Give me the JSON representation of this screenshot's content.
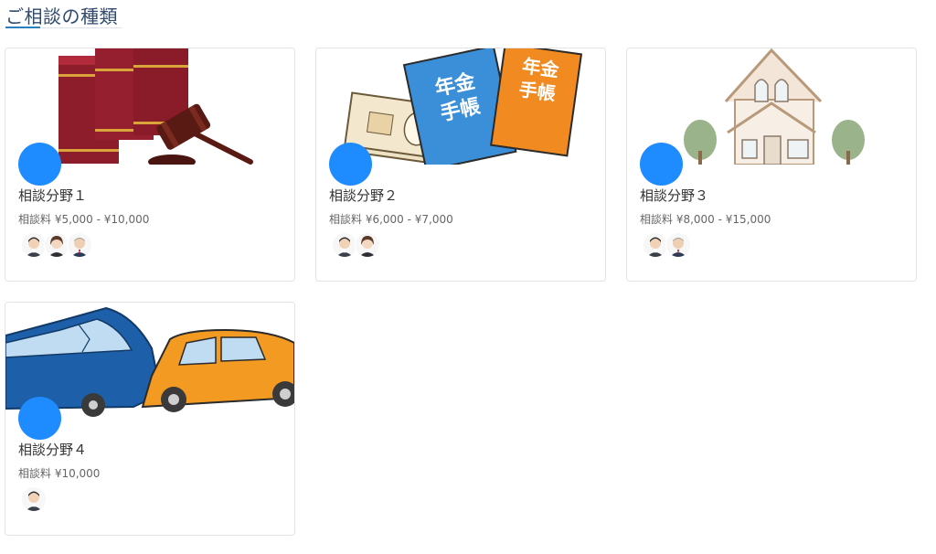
{
  "page": {
    "heading": "ご相談の種類"
  },
  "categories": [
    {
      "title": "相談分野１",
      "fee": "相談料 ¥5,000 - ¥10,000",
      "image_icon": "books-gavel-icon",
      "consultant_count": 3
    },
    {
      "title": "相談分野２",
      "fee": "相談料 ¥6,000 - ¥7,000",
      "image_icon": "pension-book-money-icon",
      "consultant_count": 2,
      "image_text": [
        "年金",
        "手帳"
      ]
    },
    {
      "title": "相談分野３",
      "fee": "相談料 ¥8,000 - ¥15,000",
      "image_icon": "house-icon",
      "consultant_count": 2
    },
    {
      "title": "相談分野４",
      "fee": "相談料 ¥10,000",
      "image_icon": "car-crash-icon",
      "consultant_count": 1
    }
  ],
  "colors": {
    "accent": "#1e8cff",
    "heading": "#2f4a6d"
  }
}
